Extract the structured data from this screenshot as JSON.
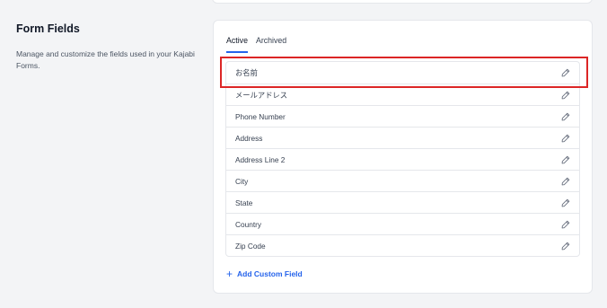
{
  "section": {
    "title": "Form Fields",
    "description": "Manage and customize the fields used in your Kajabi Forms."
  },
  "tabs": [
    {
      "label": "Active"
    },
    {
      "label": "Archived"
    }
  ],
  "fields": [
    {
      "label": "お名前",
      "icon": "pencil-icon"
    },
    {
      "label": "メールアドレス",
      "icon": "pencil-icon"
    },
    {
      "label": "Phone Number",
      "icon": "pencil-icon"
    },
    {
      "label": "Address",
      "icon": "pencil-icon"
    },
    {
      "label": "Address Line 2",
      "icon": "pencil-icon"
    },
    {
      "label": "City",
      "icon": "pencil-icon"
    },
    {
      "label": "State",
      "icon": "pencil-icon"
    },
    {
      "label": "Country",
      "icon": "pencil-icon"
    },
    {
      "label": "Zip Code",
      "icon": "pencil-icon"
    }
  ],
  "add_field": {
    "icon": "plus-icon",
    "label": "Add Custom Field"
  },
  "colors": {
    "accent": "#2563eb",
    "highlight": "#dc2626"
  }
}
